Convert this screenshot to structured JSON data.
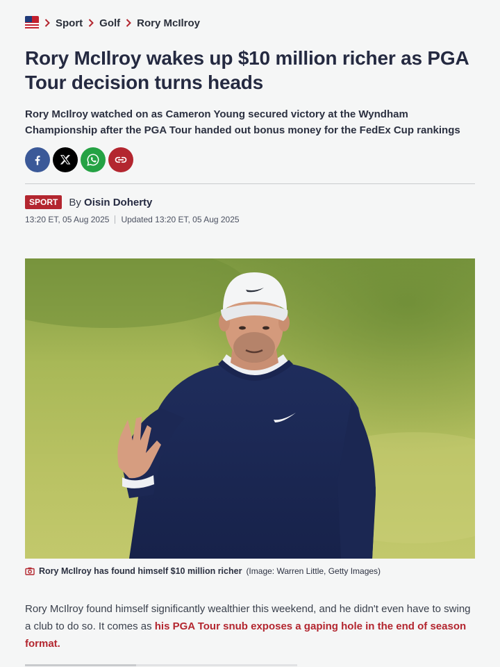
{
  "breadcrumb": {
    "items": [
      {
        "label": "Sport"
      },
      {
        "label": "Golf"
      },
      {
        "label": "Rory McIlroy"
      }
    ]
  },
  "article": {
    "headline": "Rory McIlroy wakes up $10 million richer as PGA Tour decision turns heads",
    "standfirst": "Rory McIlroy watched on as Cameron Young secured victory at the Wyndham Championship after the PGA Tour handed out bonus money for the FedEx Cup rankings",
    "section_tag": "SPORT",
    "by_prefix": "By",
    "author": "Oisin Doherty",
    "published": "13:20 ET, 05 Aug 2025",
    "updated": "Updated 13:20 ET, 05 Aug 2025"
  },
  "share": {
    "buttons": [
      {
        "icon": "facebook-icon",
        "color": "#3b5998"
      },
      {
        "icon": "x-icon",
        "color": "#000000"
      },
      {
        "icon": "whatsapp-icon",
        "color": "#25a244"
      },
      {
        "icon": "link-icon",
        "color": "#b3262f"
      }
    ]
  },
  "image": {
    "caption": "Rory McIlroy has found himself $10 million richer",
    "credit": "(Image: Warren Little, Getty Images)",
    "caption_icon": "camera-icon"
  },
  "body": {
    "para1_text": "Rory McIlroy found himself significantly wealthier this weekend, and he didn't even have to swing a club to do so. It comes as ",
    "para1_link": "his PGA Tour snub exposes a gaping hole in the end of season format."
  },
  "colors": {
    "accent": "#b3262f",
    "headline": "#252a41",
    "background": "#f5f6f6"
  }
}
